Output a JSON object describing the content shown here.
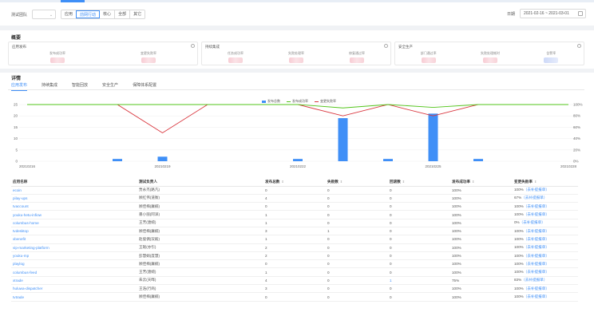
{
  "filter": {
    "team_label": "测试团队",
    "segments": [
      "应用",
      "前网行动",
      "核心",
      "全部",
      "其它"
    ],
    "active_index": 1,
    "date_label": "日期",
    "date_range": "2021-02-16 ~ 2021-03-01"
  },
  "overview": {
    "title": "概要",
    "cards": [
      {
        "title": "应用发布",
        "metrics": [
          "发布成功率",
          "变更失败率"
        ]
      },
      {
        "title": "持续集成",
        "metrics": [
          "任务成功率",
          "失败处理率",
          "修复通过率"
        ]
      },
      {
        "title": "安全生产",
        "metrics": [
          "部门通过率",
          "失败处理耗时",
          "告警率"
        ]
      }
    ]
  },
  "details": {
    "title": "详情",
    "tabs": [
      "应用发布",
      "持续集成",
      "智能回放",
      "安全生产",
      "保障体系配置"
    ],
    "active_tab": 0
  },
  "chart_data": {
    "type": "bar",
    "legend": [
      "发布总数",
      "发布成功率",
      "变更失败率"
    ],
    "colors": {
      "bar": "#3f8ff7",
      "success": "#52c41a",
      "fail": "#d9363e"
    },
    "categories": [
      "20210216",
      "20210217",
      "20210218",
      "20210219",
      "20210220",
      "20210221",
      "20210222",
      "20210223",
      "20210224",
      "20210225",
      "20210226",
      "20210227",
      "20210228"
    ],
    "x_tick_labels": [
      "20210216",
      "20210219",
      "20210222",
      "20210225",
      "20210228"
    ],
    "series": [
      {
        "name": "发布总数",
        "axis": "left",
        "values": [
          0,
          0,
          1,
          2,
          0,
          0,
          1,
          19,
          1,
          21,
          1,
          0,
          0
        ]
      },
      {
        "name": "发布成功率",
        "axis": "right",
        "values": [
          100,
          100,
          100,
          100,
          100,
          100,
          100,
          94,
          100,
          95,
          100,
          100,
          100
        ]
      },
      {
        "name": "变更失败率",
        "axis": "right",
        "values": [
          100,
          100,
          100,
          50,
          100,
          100,
          100,
          80,
          100,
          80,
          100,
          100,
          100
        ]
      }
    ],
    "y_left_ticks": [
      "0",
      "5",
      "10",
      "15",
      "20",
      "25"
    ],
    "y_right_ticks": [
      "0%",
      "20%",
      "40%",
      "60%",
      "80%",
      "100%"
    ],
    "ylim_left": [
      0,
      25
    ],
    "ylim_right": [
      0,
      100
    ]
  },
  "table": {
    "headers": [
      "应用名称",
      "测试负责人",
      "发布总数",
      "失败数",
      "回滚数",
      "发布成功率",
      "变更失败率"
    ],
    "link_text": "去补提报单",
    "rows": [
      [
        "ecoin",
        "贾永杰(路凡)",
        "0",
        "0",
        "0",
        "100%",
        "100%"
      ],
      [
        "pilay-ups",
        "顾红伟(道衡)",
        "4",
        "0",
        "0",
        "100%",
        "67%"
      ],
      [
        "tvaccount",
        "顾佳梅(庸楠)",
        "0",
        "0",
        "0",
        "100%",
        "100%"
      ],
      [
        "youku-hetu-infiow",
        "暴小丽(阿泽)",
        "1",
        "0",
        "0",
        "100%",
        "100%"
      ],
      [
        "columbus-home",
        "王芳(唐婉)",
        "1",
        "0",
        "0",
        "100%",
        "0%"
      ],
      [
        "tvdesktop",
        "顾佳梅(庸楠)",
        "3",
        "1",
        "0",
        "100%",
        "100%"
      ],
      [
        "xbenefit",
        "赵俊偶(双殿)",
        "1",
        "0",
        "0",
        "100%",
        "100%"
      ],
      [
        "vip-marketing-platform",
        "王珉(亦引)",
        "2",
        "0",
        "0",
        "100%",
        "100%"
      ],
      [
        "youku-mp",
        "彭慧娟(度慧)",
        "2",
        "0",
        "0",
        "100%",
        "100%"
      ],
      [
        "playlog",
        "顾佳梅(庸楠)",
        "0",
        "0",
        "0",
        "100%",
        "100%"
      ],
      [
        "columbus-feed",
        "王芳(唐婉)",
        "1",
        "0",
        "0",
        "100%",
        "100%"
      ],
      [
        "xtrade",
        "朱云(天晔)",
        "4",
        "0",
        "1",
        "75%",
        "83%"
      ],
      [
        "huluwa-dispatcher",
        "王浩(行商)",
        "3",
        "0",
        "0",
        "100%",
        "100%"
      ],
      [
        "tvtrade",
        "顾佳梅(庸楠)",
        "0",
        "0",
        "0",
        "100%",
        "100%"
      ]
    ]
  }
}
